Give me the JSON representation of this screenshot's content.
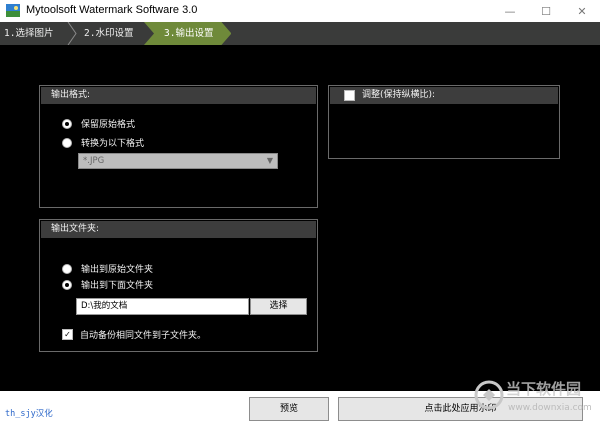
{
  "window": {
    "title": "Mytoolsoft Watermark Software 3.0",
    "minimize_glyph": "—",
    "maximize_glyph": "☐",
    "close_glyph": "✕"
  },
  "tabs": [
    {
      "label": "1.选择图片",
      "active": false
    },
    {
      "label": "2.水印设置",
      "active": false
    },
    {
      "label": "3.输出设置",
      "active": true
    }
  ],
  "output_format": {
    "title": "输出格式:",
    "options": [
      {
        "label": "保留原始格式",
        "selected": true
      },
      {
        "label": "转换为以下格式",
        "selected": false
      }
    ],
    "format_select": {
      "value": "*.JPG",
      "enabled": false
    }
  },
  "adjust": {
    "checkbox_label": "调整(保持纵横比):",
    "checked": false
  },
  "output_folder": {
    "title": "输出文件夹:",
    "options": [
      {
        "label": "输出到原始文件夹",
        "selected": false
      },
      {
        "label": "输出到下面文件夹",
        "selected": true
      }
    ],
    "path_value": "D:\\我的文档",
    "browse_label": "选择",
    "backup_checkbox_label": "自动备份相同文件到子文件夹。",
    "backup_checked": true,
    "check_mark": "✓"
  },
  "footer": {
    "credit": "th_sjy汉化",
    "preview_label": "预览",
    "apply_label": "点击此处应用水印"
  },
  "watermark_overlay": {
    "brand": "当下软件园",
    "url": "www.downxia.com"
  },
  "colors": {
    "tab_bar": "#3a3b3a",
    "tab_active": "#6f8a3a",
    "panel_header": "#3d3d3d",
    "content_bg": "#000000",
    "credit_text": "#2c67c9"
  }
}
